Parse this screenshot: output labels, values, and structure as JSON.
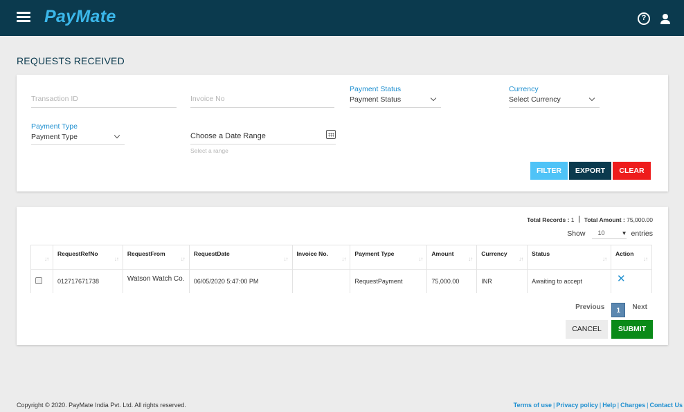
{
  "app": {
    "brand": "PayMate",
    "help_symbol": "?"
  },
  "page": {
    "title": "REQUESTS RECEIVED"
  },
  "filters": {
    "transaction_id_placeholder": "Transaction ID",
    "invoice_no_placeholder": "Invoice No",
    "payment_status": {
      "label": "Payment Status",
      "value": "Payment Status"
    },
    "currency": {
      "label": "Currency",
      "value": "Select Currency"
    },
    "payment_type": {
      "label": "Payment Type",
      "value": "Payment Type"
    },
    "date_range": {
      "value": "Choose a Date Range",
      "hint": "Select a range"
    },
    "buttons": {
      "filter": "FILTER",
      "export": "EXPORT",
      "clear": "CLEAR"
    }
  },
  "summary": {
    "total_records_label": "Total Records :",
    "total_records_value": "1",
    "total_amount_label": "Total Amount :",
    "total_amount_value": "75,000.00"
  },
  "show": {
    "prefix": "Show",
    "value": "10",
    "suffix": "entries"
  },
  "table": {
    "columns": [
      "RequestRefNo",
      "RequestFrom",
      "RequestDate",
      "Invoice No.",
      "Payment Type",
      "Amount",
      "Currency",
      "Status",
      "Action"
    ],
    "rows": [
      {
        "ref_no": "012717671738",
        "from": "Watson Watch Co.",
        "date": "06/05/2020 5:47:00 PM",
        "invoice_no": "",
        "payment_type": "RequestPayment",
        "amount": "75,000.00",
        "currency": "INR",
        "status": "Awaiting to accept",
        "action_icon": "close-icon"
      }
    ]
  },
  "pagination": {
    "previous": "Previous",
    "current": "1",
    "next": "Next"
  },
  "actions": {
    "cancel": "CANCEL",
    "submit": "SUBMIT"
  },
  "footer": {
    "copyright": "Copyright © 2020. PayMate India Pvt. Ltd. All rights reserved.",
    "links": [
      "Terms of use",
      "Privacy policy",
      "Help",
      "Charges",
      "Contact Us"
    ]
  },
  "colors": {
    "header_bg": "#0b3a4e",
    "brand": "#3bb7ea",
    "link": "#1e8fd0",
    "filter_btn": "#4fc3f7",
    "export_btn": "#0b3a4e",
    "clear_btn": "#ee1c1c",
    "submit_btn": "#0a8a18"
  }
}
